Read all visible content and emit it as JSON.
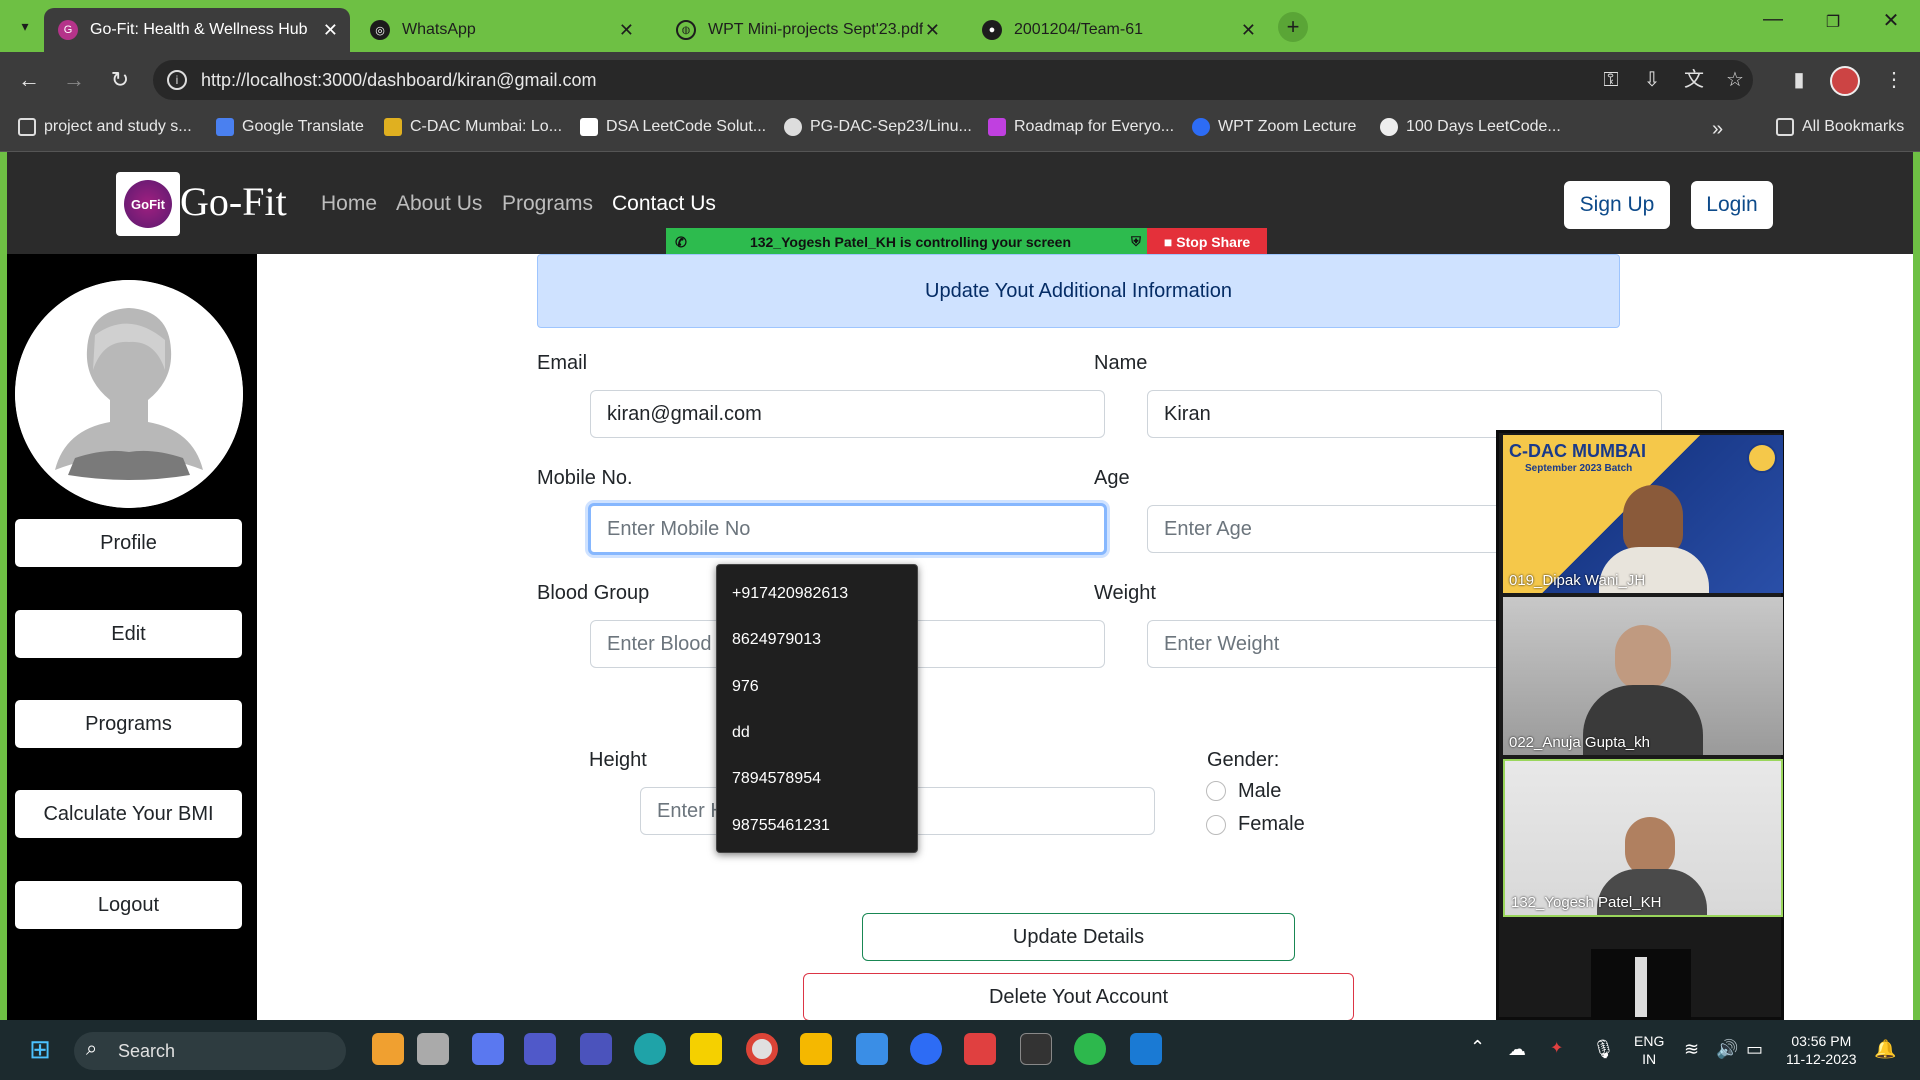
{
  "browser": {
    "tabs": [
      {
        "title": "Go-Fit: Health & Wellness Hub",
        "active": true
      },
      {
        "title": "WhatsApp",
        "active": false
      },
      {
        "title": "WPT Mini-projects Sept'23.pdf",
        "active": false
      },
      {
        "title": "2001204/Team-61",
        "active": false
      }
    ],
    "url": "http://localhost:3000/dashboard/kiran@gmail.com",
    "bookmarks": [
      "project and study s...",
      "Google Translate",
      "C-DAC Mumbai: Lo...",
      "DSA LeetCode Solut...",
      "PG-DAC-Sep23/Linu...",
      "Roadmap for Everyo...",
      "WPT Zoom Lecture",
      "100 Days LeetCode..."
    ],
    "all_bookmarks": "All Bookmarks"
  },
  "site": {
    "logo_text": "GoFit",
    "brand": "Go-Fit",
    "nav": [
      "Home",
      "About Us",
      "Programs",
      "Contact Us"
    ],
    "signup": "Sign Up",
    "login": "Login"
  },
  "screenshare": {
    "message": "132_Yogesh Patel_KH is controlling your screen",
    "stop": "Stop Share"
  },
  "sidebar": {
    "buttons": [
      "Profile",
      "Edit",
      "Programs",
      "Calculate Your BMI",
      "Logout"
    ]
  },
  "form": {
    "header": "Update Yout Additional Information",
    "email_label": "Email",
    "email_value": "kiran@gmail.com",
    "name_label": "Name",
    "name_value": "Kiran",
    "mobile_label": "Mobile No.",
    "mobile_placeholder": "Enter Mobile No",
    "age_label": "Age",
    "age_placeholder": "Enter Age",
    "blood_label": "Blood Group",
    "blood_placeholder": "Enter Blood",
    "weight_label": "Weight",
    "weight_placeholder": "Enter Weight",
    "height_label": "Height",
    "height_placeholder": "Enter H",
    "gender_label": "Gender:",
    "gender_options": [
      "Male",
      "Female"
    ],
    "update_button": "Update Details",
    "delete_button": "Delete Yout Account"
  },
  "autocomplete": [
    "+917420982613",
    "8624979013",
    "976",
    "dd",
    "7894578954",
    "98755461231"
  ],
  "zoom": {
    "banner_title": "C-DAC MUMBAI",
    "banner_sub": "September 2023 Batch",
    "participants": [
      "019_Dipak Wani_JH",
      "022_Anuja Gupta_kh",
      "132_Yogesh Patel_KH"
    ]
  },
  "taskbar": {
    "search": "Search",
    "lang1": "ENG",
    "lang2": "IN",
    "time": "03:56 PM",
    "date": "11-12-2023"
  },
  "colors": {
    "browser_frame": "#6ec044",
    "site_nav": "#2b2b2b",
    "info_box": "#cfe2ff",
    "share_bar": "#2dbb4e",
    "stop_share": "#e4303a",
    "update_border": "#198754",
    "delete_border": "#dc3545"
  }
}
